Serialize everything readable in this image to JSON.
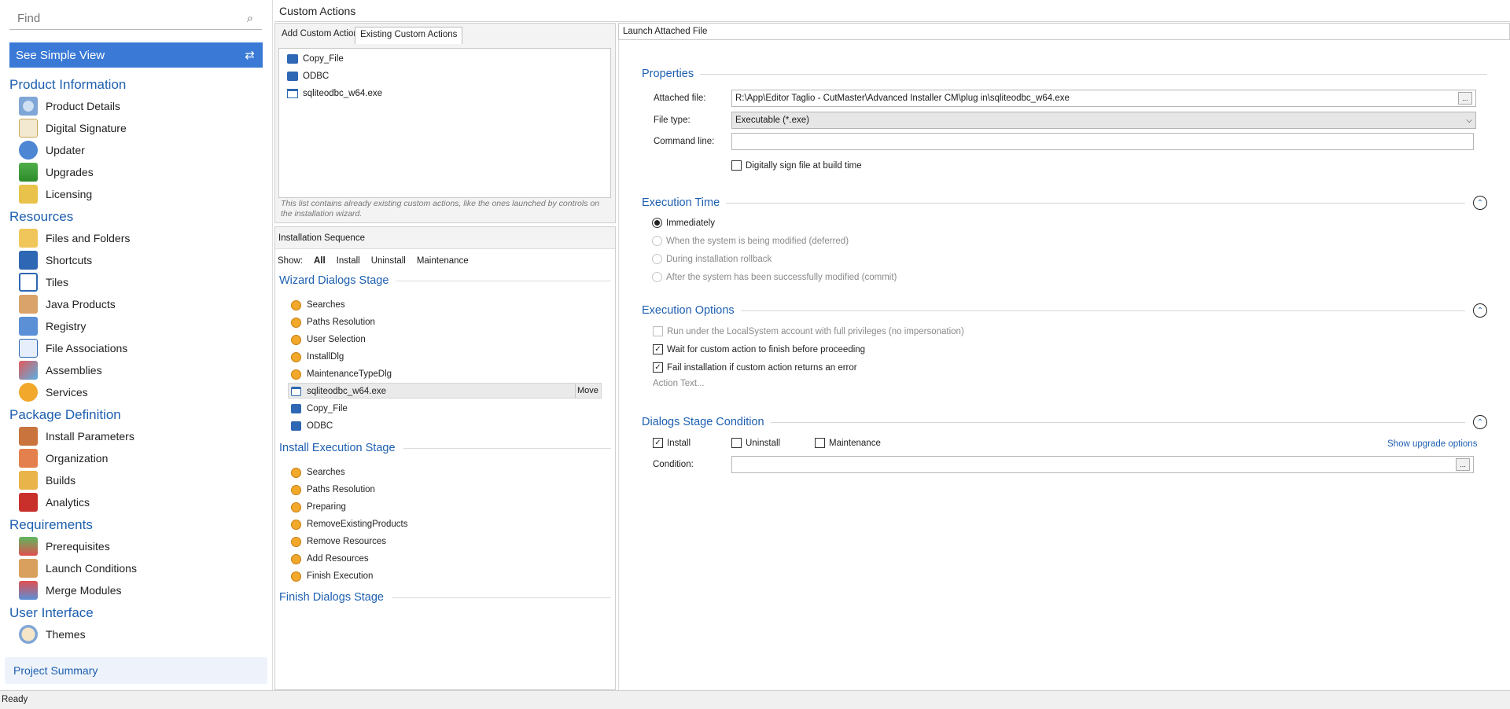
{
  "left": {
    "find_placeholder": "Find",
    "simple_view_label": "See Simple View",
    "sections": [
      {
        "title": "Product Information",
        "items": [
          "Product Details",
          "Digital Signature",
          "Updater",
          "Upgrades",
          "Licensing"
        ]
      },
      {
        "title": "Resources",
        "items": [
          "Files and Folders",
          "Shortcuts",
          "Tiles",
          "Java Products",
          "Registry",
          "File Associations",
          "Assemblies",
          "Services"
        ]
      },
      {
        "title": "Package Definition",
        "items": [
          "Install Parameters",
          "Organization",
          "Builds",
          "Analytics"
        ]
      },
      {
        "title": "Requirements",
        "items": [
          "Prerequisites",
          "Launch Conditions",
          "Merge Modules"
        ]
      },
      {
        "title": "User Interface",
        "items": [
          "Themes"
        ]
      }
    ],
    "project_summary": "Project Summary"
  },
  "header": {
    "title": "Custom Actions"
  },
  "tabs": {
    "add": "Add Custom Action",
    "existing": "Existing Custom Actions"
  },
  "existing_list": [
    "Copy_File",
    "ODBC",
    "sqliteodbc_w64.exe"
  ],
  "existing_note": "This list contains already existing custom actions, like the ones launched by controls on the installation wizard.",
  "install_sequence": {
    "title": "Installation Sequence",
    "show_label": "Show:",
    "filters": [
      "All",
      "Install",
      "Uninstall",
      "Maintenance"
    ],
    "wizard_stage": "Wizard Dialogs Stage",
    "wizard_items": [
      "Searches",
      "Paths Resolution",
      "User Selection",
      "InstallDlg",
      "MaintenanceTypeDlg",
      "sqliteodbc_w64.exe",
      "Copy_File",
      "ODBC"
    ],
    "move_label": "Move",
    "exec_stage": "Install Execution Stage",
    "exec_items": [
      "Searches",
      "Paths Resolution",
      "Preparing",
      "RemoveExistingProducts",
      "Remove Resources",
      "Add Resources",
      "Finish Execution"
    ],
    "finish_stage": "Finish Dialogs Stage"
  },
  "right": {
    "title": "Launch Attached File",
    "properties": {
      "heading": "Properties",
      "attached_label": "Attached file:",
      "attached_value": "R:\\App\\Editor Taglio - CutMaster\\Advanced Installer CM\\plug in\\sqliteodbc_w64.exe",
      "filetype_label": "File type:",
      "filetype_value": "Executable (*.exe)",
      "cmdline_label": "Command line:",
      "cmdline_value": "",
      "sign_label": "Digitally sign file at build time"
    },
    "exec_time": {
      "heading": "Execution Time",
      "options": [
        "Immediately",
        "When the system is being modified (deferred)",
        "During installation rollback",
        "After the system has been successfully modified (commit)"
      ]
    },
    "exec_options": {
      "heading": "Execution Options",
      "localsystem": "Run under the LocalSystem account with full privileges (no impersonation)",
      "wait": "Wait for custom action to finish before proceeding",
      "fail": "Fail installation if custom action returns an error",
      "action_text": "Action Text..."
    },
    "dialogs_cond": {
      "heading": "Dialogs Stage Condition",
      "install": "Install",
      "uninstall": "Uninstall",
      "maintenance": "Maintenance",
      "show_upgrade": "Show upgrade options",
      "condition_label": "Condition:",
      "condition_value": ""
    }
  },
  "status": "Ready",
  "colors": {
    "accent": "#3a7ad6",
    "heading": "#1d5fb0"
  }
}
